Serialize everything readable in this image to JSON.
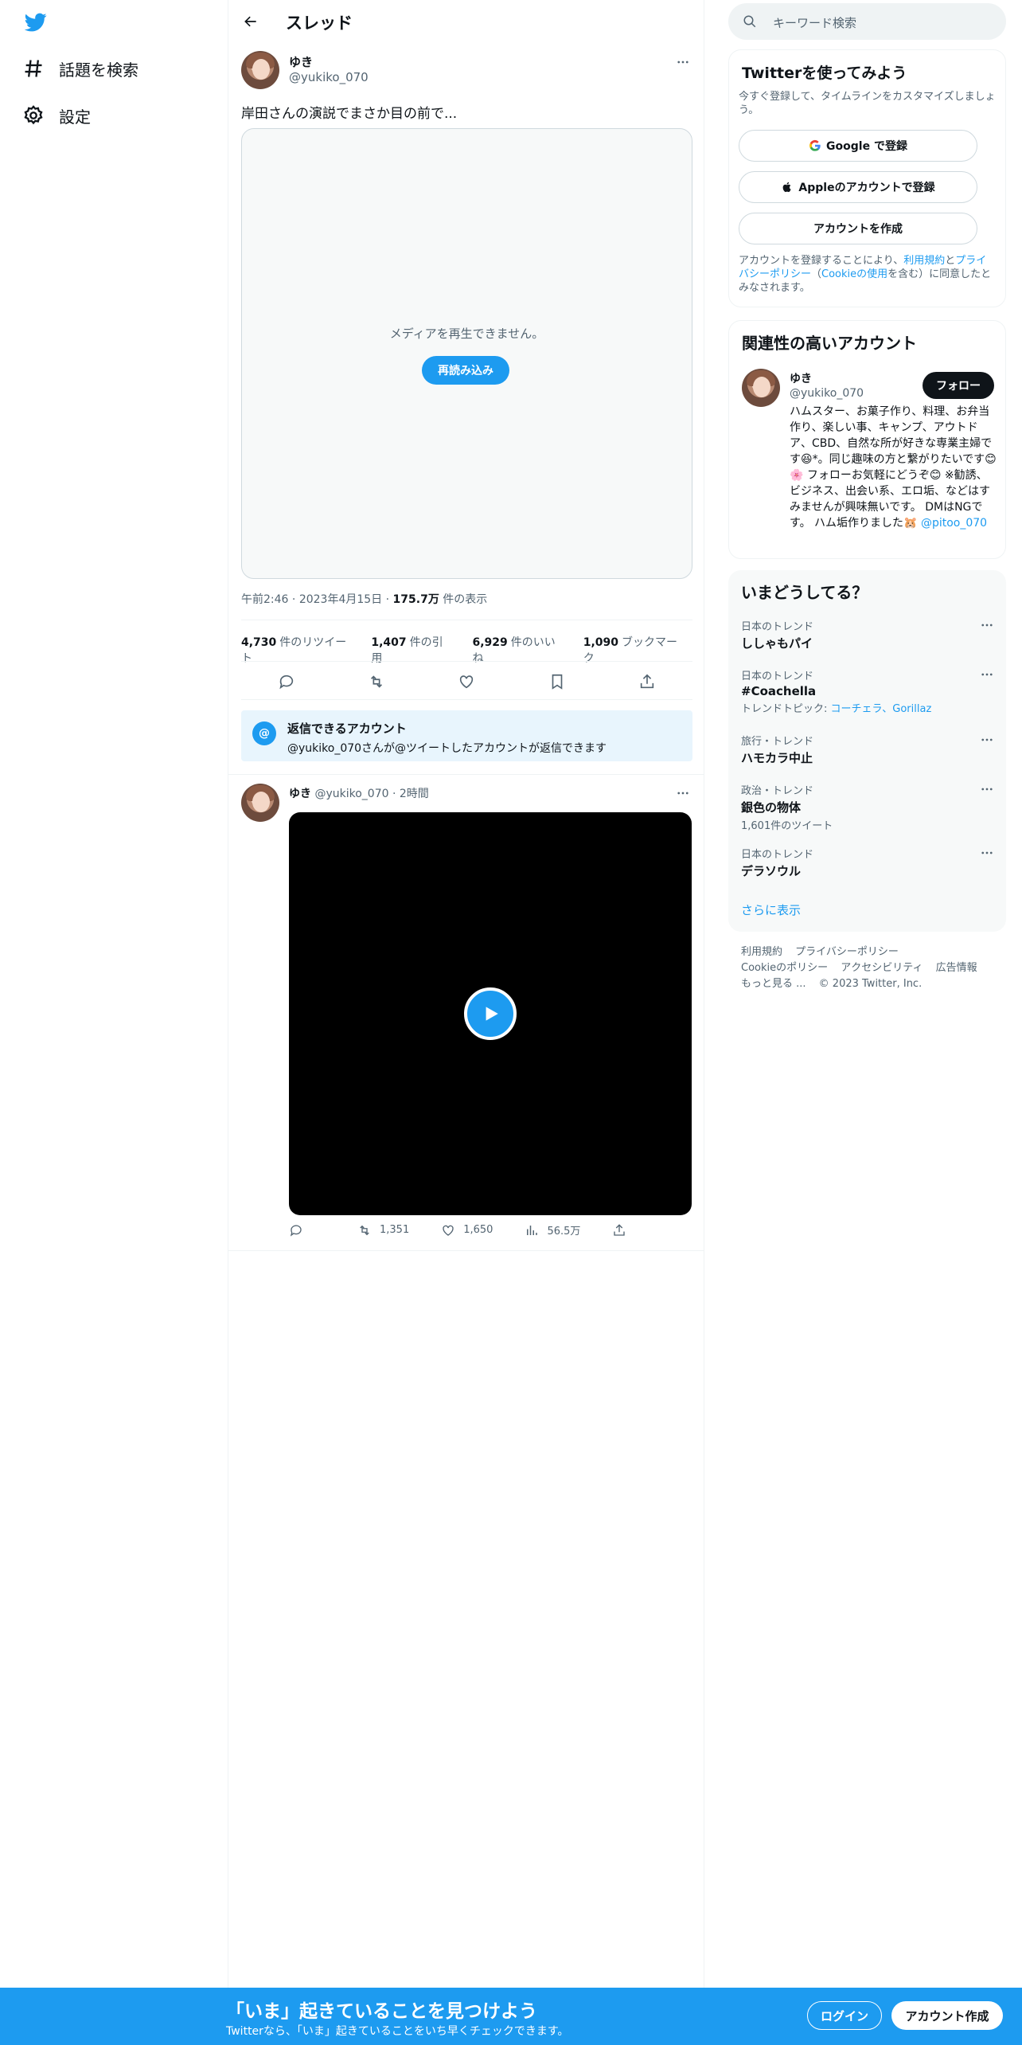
{
  "nav": {
    "explore_label": "話題を検索",
    "settings_label": "設定"
  },
  "header": {
    "title": "スレッド"
  },
  "tweet": {
    "name": "ゆき",
    "handle": "@yukiko_070",
    "text": "岸田さんの演説でまさか目の前で...",
    "media_error": "メディアを再生できません。",
    "reload_label": "再読み込み",
    "time": "午前2:46",
    "date": "2023年4月15日",
    "views": "175.7万",
    "views_suffix": "件の表示",
    "retweets": "4,730",
    "retweets_label": "件のリツイート",
    "quotes": "1,407",
    "quotes_label": "件の引用",
    "likes": "6,929",
    "likes_label": "件のいいね",
    "bookmarks": "1,090",
    "bookmarks_label": "ブックマーク"
  },
  "reply_restriction": {
    "title": "返信できるアカウント",
    "text": "@yukiko_070さんが@ツイートしたアカウントが返信できます"
  },
  "reply": {
    "name": "ゆき",
    "handle": "@yukiko_070",
    "time": "2時間",
    "retweets": "1,351",
    "likes": "1,650",
    "views": "56.5万"
  },
  "search": {
    "placeholder": "キーワード検索"
  },
  "signup": {
    "title": "Twitterを使ってみよう",
    "subtitle": "今すぐ登録して、タイムラインをカスタマイズしましょう。",
    "google": "Google で登録",
    "apple": "Appleのアカウントで登録",
    "create": "アカウントを作成",
    "legal_1": "アカウントを登録することにより、",
    "legal_terms": "利用規約",
    "legal_2": "と",
    "legal_privacy": "プライバシーポリシー",
    "legal_3": "（",
    "legal_cookie": "Cookieの使用",
    "legal_4": "を含む）に同意したとみなされます。"
  },
  "related": {
    "title": "関連性の高いアカウント",
    "name": "ゆき",
    "handle": "@yukiko_070",
    "follow_label": "フォロー",
    "bio": "ハムスター、お菓子作り、料理、お弁当作り、楽しい事、キャンプ、アウトドア、CBD、自然な所が好きな専業主婦です😆*。同じ趣味の方と繋がりたいです😊🌸 フォローお気軽にどうぞ😊 ※勧誘、ビジネス、出会い系、エロ垢、などはすみませんが興味無いです。 DMはNGです。 ハム垢作りました🐹",
    "bio_link": "@pitoo_070"
  },
  "trends": {
    "title": "いまどうしてる？",
    "items": [
      {
        "context": "日本のトレンド",
        "name": "ししゃもパイ",
        "extra": ""
      },
      {
        "context": "日本のトレンド",
        "name": "#Coachella",
        "extra": "トレンドトピック:",
        "extra_link": "コーチェラ、Gorillaz"
      },
      {
        "context": "旅行・トレンド",
        "name": "ハモカラ中止",
        "extra": ""
      },
      {
        "context": "政治・トレンド",
        "name": "銀色の物体",
        "extra": "1,601件のツイート"
      },
      {
        "context": "日本のトレンド",
        "name": "デラソウル",
        "extra": ""
      }
    ],
    "more": "さらに表示"
  },
  "footer": {
    "terms": "利用規約",
    "privacy": "プライバシーポリシー",
    "cookie": "Cookieのポリシー",
    "accessibility": "アクセシビリティ",
    "ads": "広告情報",
    "more": "もっと見る ...",
    "copyright": "© 2023 Twitter, Inc."
  },
  "banner": {
    "headline": "「いま」起きていることを見つけよう",
    "sub": "Twitterなら、「いま」起きていることをいち早くチェックできます。",
    "login": "ログイン",
    "signup": "アカウント作成"
  },
  "colors": {
    "accent": "#1d9bf0",
    "text": "#0f1419",
    "muted": "#536471"
  }
}
